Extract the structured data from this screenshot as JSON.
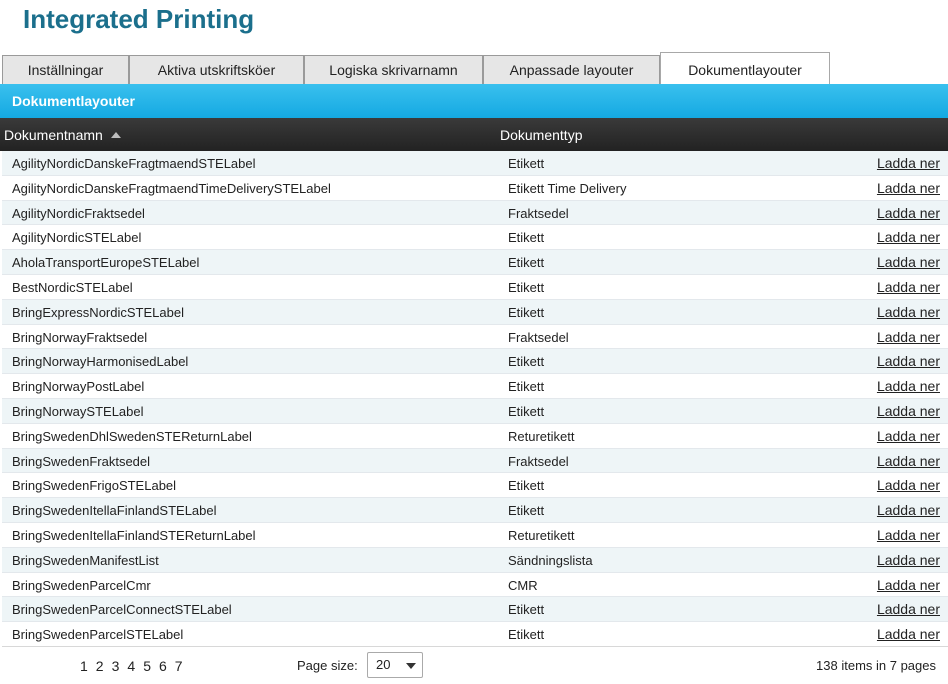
{
  "app_title": "Integrated Printing",
  "tabs": [
    {
      "label": "Inställningar",
      "active": false
    },
    {
      "label": "Aktiva utskriftsköer",
      "active": false
    },
    {
      "label": "Logiska skrivarnamn",
      "active": false
    },
    {
      "label": "Anpassade layouter",
      "active": false
    },
    {
      "label": "Dokumentlayouter",
      "active": true
    }
  ],
  "section_title": "Dokumentlayouter",
  "grid": {
    "columns": {
      "name": "Dokumentnamn",
      "type": "Dokumenttyp"
    },
    "sort": {
      "column": "Dokumentnamn",
      "direction": "ascending",
      "icon": "sort-ascending-icon"
    },
    "action_label": "Ladda ner",
    "rows": [
      {
        "name": "AgilityNordicDanskeFragtmaendSTELabel",
        "type": "Etikett"
      },
      {
        "name": "AgilityNordicDanskeFragtmaendTimeDeliverySTELabel",
        "type": "Etikett Time Delivery"
      },
      {
        "name": "AgilityNordicFraktsedel",
        "type": "Fraktsedel"
      },
      {
        "name": "AgilityNordicSTELabel",
        "type": "Etikett"
      },
      {
        "name": "AholaTransportEuropeSTELabel",
        "type": "Etikett"
      },
      {
        "name": "BestNordicSTELabel",
        "type": "Etikett"
      },
      {
        "name": "BringExpressNordicSTELabel",
        "type": "Etikett"
      },
      {
        "name": "BringNorwayFraktsedel",
        "type": "Fraktsedel"
      },
      {
        "name": "BringNorwayHarmonisedLabel",
        "type": "Etikett"
      },
      {
        "name": "BringNorwayPostLabel",
        "type": "Etikett"
      },
      {
        "name": "BringNorwaySTELabel",
        "type": "Etikett"
      },
      {
        "name": "BringSwedenDhlSwedenSTEReturnLabel",
        "type": "Returetikett"
      },
      {
        "name": "BringSwedenFraktsedel",
        "type": "Fraktsedel"
      },
      {
        "name": "BringSwedenFrigoSTELabel",
        "type": "Etikett"
      },
      {
        "name": "BringSwedenItellaFinlandSTELabel",
        "type": "Etikett"
      },
      {
        "name": "BringSwedenItellaFinlandSTEReturnLabel",
        "type": "Returetikett"
      },
      {
        "name": "BringSwedenManifestList",
        "type": "Sändningslista"
      },
      {
        "name": "BringSwedenParcelCmr",
        "type": "CMR"
      },
      {
        "name": "BringSwedenParcelConnectSTELabel",
        "type": "Etikett"
      },
      {
        "name": "BringSwedenParcelSTELabel",
        "type": "Etikett"
      }
    ]
  },
  "pager": {
    "pages": [
      "1",
      "2",
      "3",
      "4",
      "5",
      "6",
      "7"
    ],
    "current_page": "1",
    "page_size_label": "Page size:",
    "page_size_value": "20",
    "items_info": "138 items in 7 pages"
  },
  "colors": {
    "title": "#1b6f8c",
    "section_bar": "#1aaee5",
    "grid_header": "#2b2b2b",
    "alt_row": "#eef5f7"
  }
}
